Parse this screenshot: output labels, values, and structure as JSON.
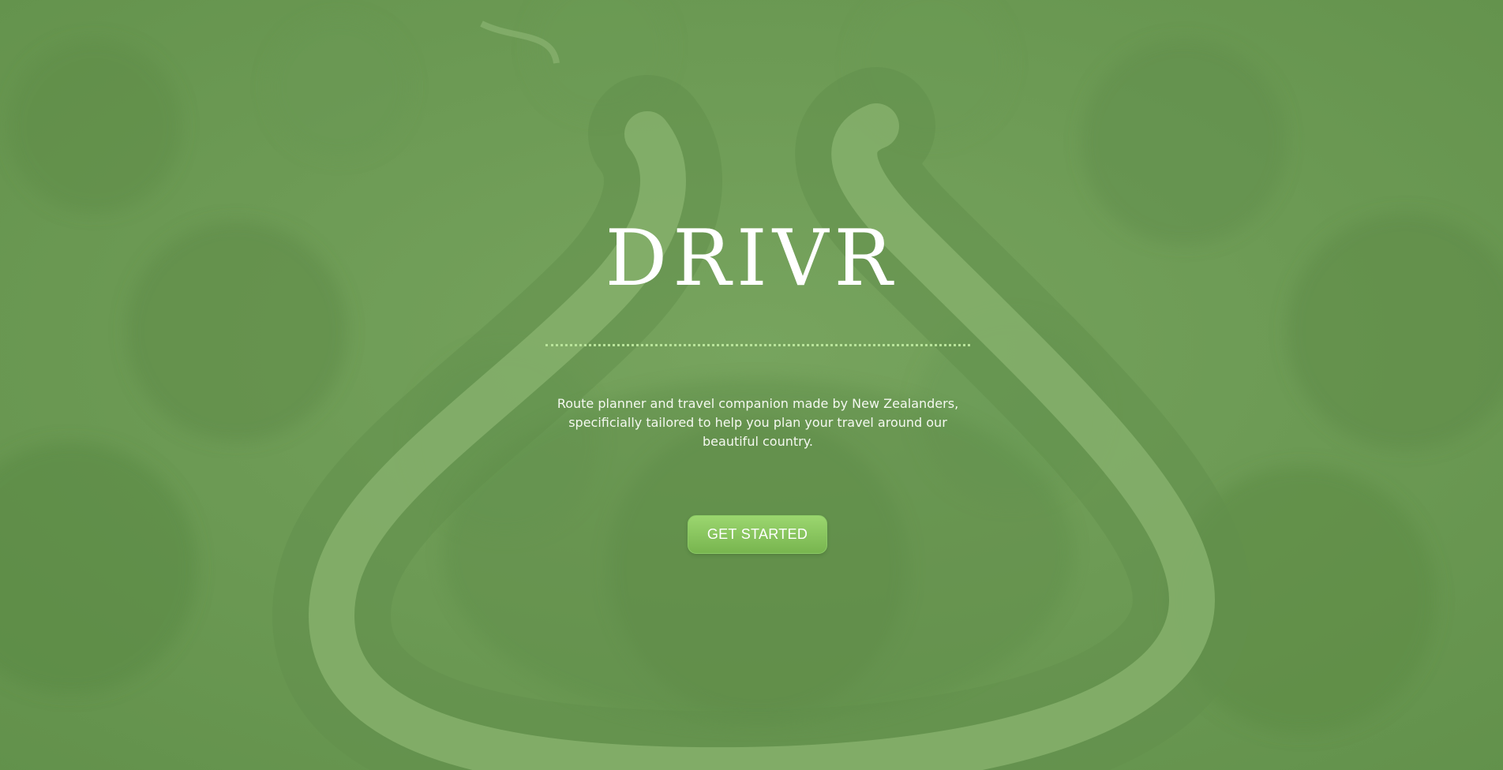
{
  "hero": {
    "title": "DRIVR",
    "tagline": "Route planner and travel companion made by New Zealanders, specificially tailored to help you plan your travel around our beautiful country.",
    "cta_label": "GET STARTED",
    "background": "aerial-forest-road-photo"
  },
  "colors": {
    "overlay_green": "#6f9e57",
    "road_green": "#86b06c",
    "divider_dots": "#b8e39a",
    "button_top": "#9bd66f",
    "button_bottom": "#78b54f",
    "text": "#ffffff"
  }
}
